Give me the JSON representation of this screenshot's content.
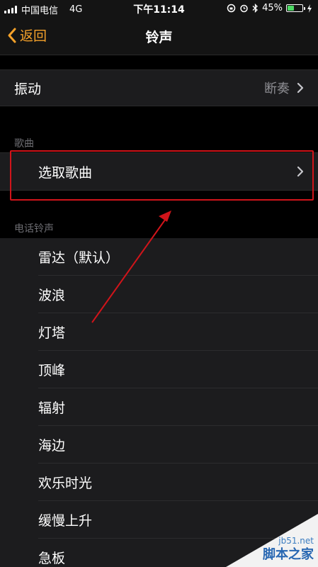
{
  "status_bar": {
    "carrier": "中国电信",
    "network": "4G",
    "time": "下午11:14",
    "battery_percent": "45%",
    "battery_level": 0.45
  },
  "nav": {
    "back_label": "返回",
    "title": "铃声"
  },
  "vibration": {
    "label": "振动",
    "value": "断奏"
  },
  "songs_section": {
    "header": "歌曲",
    "pick_label": "选取歌曲"
  },
  "ringtones_section": {
    "header": "电话铃声",
    "items": [
      "雷达（默认）",
      "波浪",
      "灯塔",
      "顶峰",
      "辐射",
      "海边",
      "欢乐时光",
      "缓慢上升",
      "急板"
    ]
  },
  "watermark": {
    "url": "jb51.net",
    "brand": "脚本之家"
  },
  "colors": {
    "accent": "#f6a22a",
    "highlight": "#d0141a",
    "battery": "#4cd964"
  }
}
